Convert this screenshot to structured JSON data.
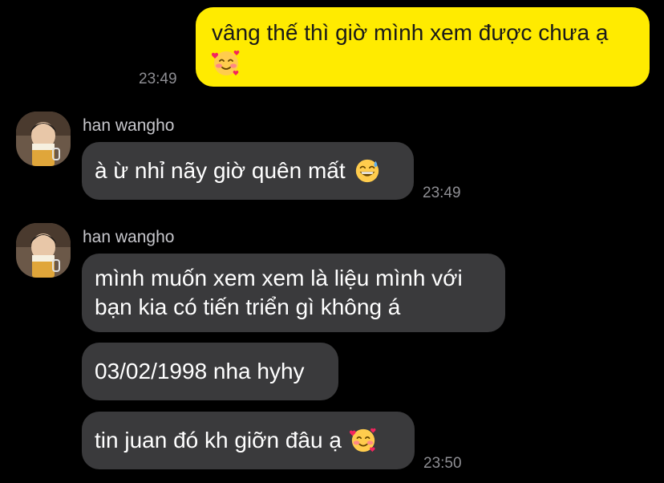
{
  "messages": [
    {
      "direction": "outgoing",
      "text_line1": "vâng thế thì giờ mình xem được chưa ạ",
      "emoji": "smiling-face-with-hearts-icon",
      "time": "23:49"
    },
    {
      "direction": "incoming",
      "sender": "han wangho",
      "text": "à ừ nhỉ nãy giờ quên mất",
      "emoji": "grinning-face-with-sweat-icon",
      "time": "23:49"
    },
    {
      "direction": "incoming",
      "sender": "han wangho",
      "text_line1": "mình muốn xem xem là liệu mình với",
      "text_line2": "bạn kia có tiến triển gì không á"
    },
    {
      "direction": "incoming",
      "text": "03/02/1998 nha hyhy"
    },
    {
      "direction": "incoming",
      "text": "tin juan đó kh giỡn đâu ạ",
      "emoji": "smiling-face-with-hearts-icon",
      "time": "23:50"
    }
  ],
  "colors": {
    "background": "#000000",
    "outgoing_bubble": "#FFEB00",
    "incoming_bubble": "#3A3A3C",
    "timestamp": "#8E8E93"
  }
}
